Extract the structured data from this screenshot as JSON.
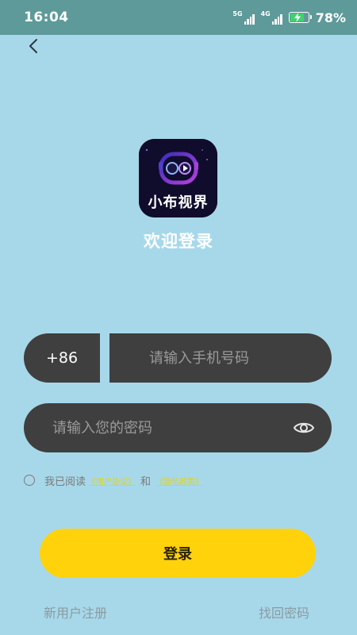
{
  "status_bar": {
    "time": "16:04",
    "network_1": "5G",
    "network_2": "4G",
    "battery_percent_text": "78%",
    "battery_level": 0.78,
    "battery_color": "#3fd26e"
  },
  "header": {
    "back_icon": "chevron-left-icon"
  },
  "logo": {
    "text": "小布视界"
  },
  "welcome_title": "欢迎登录",
  "phone": {
    "country_code": "+86",
    "placeholder": "请输入手机号码",
    "value": ""
  },
  "password": {
    "placeholder": "请输入您的密码",
    "value": "",
    "toggle_icon": "eye-icon"
  },
  "agreement": {
    "prefix": "我已阅读",
    "user_agreement": "《用户协议》",
    "connector": "和",
    "privacy_policy": "《隐私政策》",
    "checked": false
  },
  "login_button": "登录",
  "footer": {
    "register": "新用户注册",
    "forgot_password": "找回密码"
  },
  "colors": {
    "background": "#a7d8ea",
    "status_bar": "#5e9a9a",
    "input_bg": "#3f3f3f",
    "primary": "#ffd20c",
    "link": "#e2d41a"
  }
}
